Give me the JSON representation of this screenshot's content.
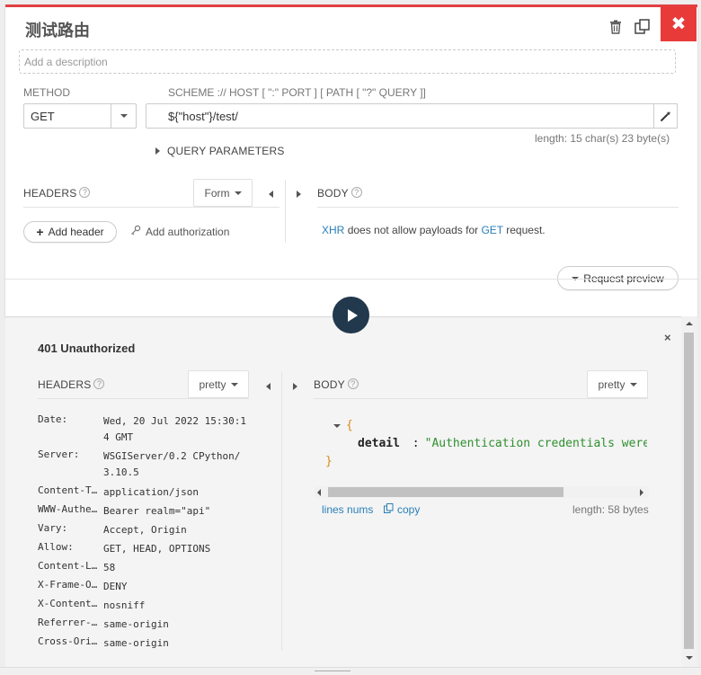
{
  "request": {
    "title": "测试路由",
    "description_placeholder": "Add a description",
    "method_label": "METHOD",
    "method_value": "GET",
    "url_scheme_label": "SCHEME :// HOST [ \":\" PORT ] [ PATH [ \"?\" QUERY ]]",
    "url_value": "${\"host\"}/test/",
    "length_info": "length: 15 char(s) 23 byte(s)",
    "query_params_label": "QUERY PARAMETERS",
    "headers_label": "HEADERS",
    "headers_mode": "Form",
    "add_header_label": "Add header",
    "add_authorization_label": "Add authorization",
    "body_label": "BODY",
    "body_notice_xhr": "XHR",
    "body_notice_mid": "does not allow payloads for",
    "body_notice_method": "GET",
    "body_notice_end": "request.",
    "request_preview_label": "Request preview"
  },
  "response": {
    "status": "401 Unauthorized",
    "headers_label": "HEADERS",
    "headers_format": "pretty",
    "body_label": "BODY",
    "body_format": "pretty",
    "headers": [
      {
        "key": "Date:",
        "value": "Wed, 20 Jul 2022 15:30:1\n4 GMT"
      },
      {
        "key": "Server:",
        "value": "WSGIServer/0.2 CPython/\n3.10.5"
      },
      {
        "key": "Content-T…",
        "value": "application/json"
      },
      {
        "key": "WWW-Authe…",
        "value": "Bearer realm=\"api\""
      },
      {
        "key": "Vary:",
        "value": "Accept, Origin"
      },
      {
        "key": "Allow:",
        "value": "GET, HEAD, OPTIONS"
      },
      {
        "key": "Content-L…",
        "value": "58"
      },
      {
        "key": "X-Frame-O…",
        "value": "DENY"
      },
      {
        "key": "X-Content…",
        "value": "nosniff"
      },
      {
        "key": "Referrer-…",
        "value": "same-origin"
      },
      {
        "key": "Cross-Ori…",
        "value": "same-origin"
      }
    ],
    "json_open": "{",
    "json_key": "detail",
    "json_colon": ":",
    "json_value": "\"Authentication credentials were",
    "json_close": "}",
    "lines_nums_label": "lines nums",
    "copy_label": "copy",
    "body_length": "length: 58 bytes"
  },
  "colors": {
    "accent_red": "#e93a3a",
    "send_button": "#21384d",
    "link_blue": "#2a7fb8",
    "json_string_green": "#2f8f2f",
    "json_brace_orange": "#d98a1c"
  },
  "icons": [
    "trash-icon",
    "duplicate-icon",
    "close-icon",
    "wand-icon",
    "play-icon",
    "key-icon",
    "plus-icon",
    "copy-icon",
    "chevron-down-icon"
  ]
}
